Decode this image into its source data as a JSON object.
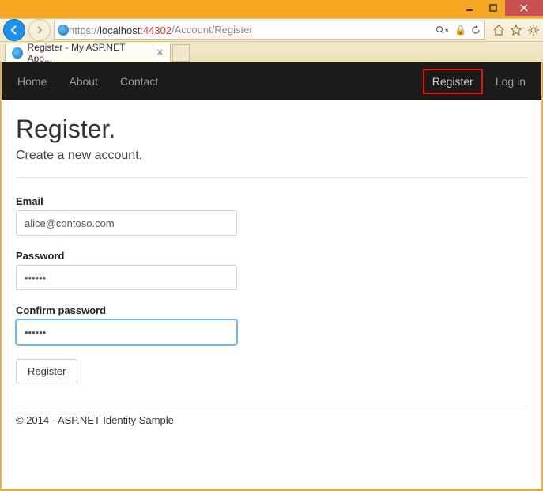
{
  "window": {
    "url_protocol": "https://",
    "url_host": "localhost",
    "url_port": ":44302",
    "url_path": "/Account/Register",
    "tab_title": "Register - My ASP.NET App..."
  },
  "navbar": {
    "home": "Home",
    "about": "About",
    "contact": "Contact",
    "register": "Register",
    "login": "Log in"
  },
  "page": {
    "title": "Register.",
    "subtitle": "Create a new account.",
    "email_label": "Email",
    "email_value": "alice@contoso.com",
    "password_label": "Password",
    "password_value": "••••••",
    "confirm_label": "Confirm password",
    "confirm_value": "••••••",
    "submit_label": "Register"
  },
  "footer": {
    "copyright": "© 2014 - ASP.NET Identity Sample"
  }
}
